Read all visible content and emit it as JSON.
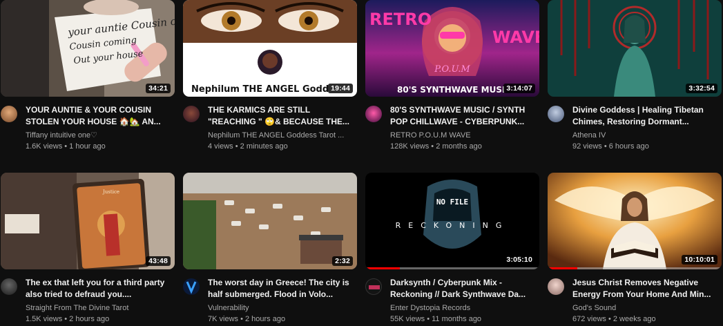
{
  "videos": [
    {
      "title": "YOUR AUNTIE & YOUR COUSIN STOLEN YOUR HOUSE 🏠🏡 AN...",
      "channel": "Tiffany intuitive one♡",
      "stats": "1.6K views • 1 hour ago",
      "duration": "34:21",
      "thumb_text": "your auntie Cousin coming Out your house",
      "avatar_color": "#b7784a"
    },
    {
      "title": "THE KARMICS ARE STILL \"REACHING \" 🙄& BECAUSE THE...",
      "channel": "Nephilum THE ANGEL Goddess Tarot ...",
      "stats": "4 views • 2 minutes ago",
      "duration": "19:44",
      "thumb_text": "Nephilum THE ANGEL Godd",
      "avatar_color": "#6b3a5a"
    },
    {
      "title": "80'S SYNTHWAVE MUSIC / SYNTH POP CHILLWAVE - CYBERPUNK...",
      "channel": "RETRO P.O.U.M WAVE",
      "stats": "128K views • 2 months ago",
      "duration": "3:14:07",
      "thumb_text": "RETRO",
      "thumb_text2": "WAVE",
      "thumb_text3": "P.O.U.M",
      "thumb_text4": "80'S SYNTHWAVE MUSI",
      "avatar_color": "#d23b7a"
    },
    {
      "title": "Divine Goddess | Healing Tibetan Chimes, Restoring Dormant...",
      "channel": "Athena IV",
      "stats": "92 views • 6 hours ago",
      "duration": "3:32:54",
      "avatar_color": "#7f8fa8"
    },
    {
      "title": "The ex that left you for a third party also tried to defraud you....",
      "channel": "Straight From The Divine Tarot",
      "stats": "1.5K views • 2 hours ago",
      "duration": "43:48",
      "thumb_text": "Justice",
      "avatar_color": "#3a3a3a"
    },
    {
      "title": "The worst day in Greece! The city is half submerged. Flood in Volo...",
      "channel": "Vulnerability",
      "stats": "7K views • 2 hours ago",
      "duration": "2:32",
      "avatar_color": "#0a1a3a"
    },
    {
      "title": "Darksynth / Cyberpunk Mix - Reckoning // Dark Synthwave Da...",
      "channel": "Enter Dystopia Records",
      "stats": "55K views • 11 months ago",
      "duration": "3:05:10",
      "thumb_text": "RECKONING",
      "thumb_text2": "NO FILE",
      "progress": 0.2,
      "avatar_color": "#1a1a1a"
    },
    {
      "title": "Jesus Christ Removes Negative Energy From Your Home And Min...",
      "channel": "God's Sound",
      "stats": "672 views • 2 weeks ago",
      "duration": "10:10:01",
      "progress": 0.17,
      "avatar_color": "#c9a7a0"
    }
  ]
}
